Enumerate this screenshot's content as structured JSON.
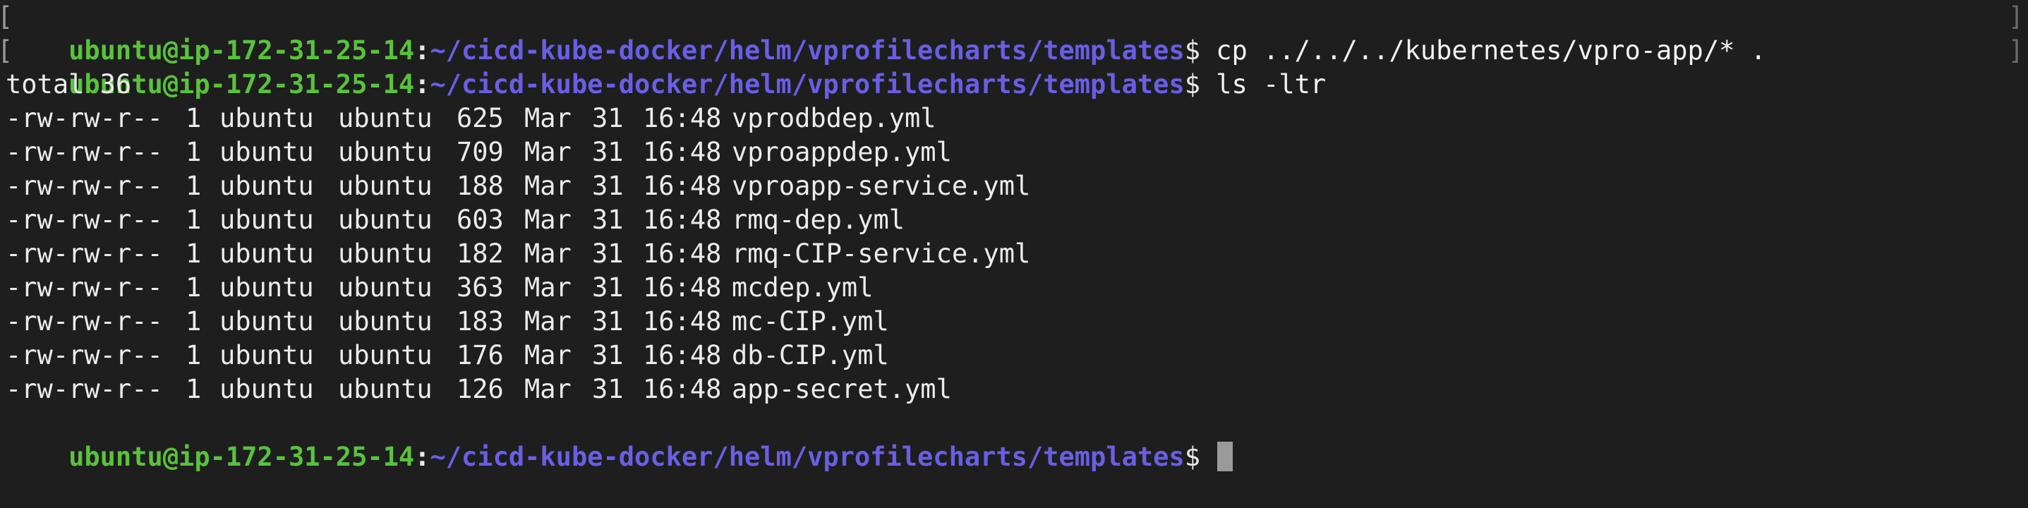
{
  "terminal": {
    "prompt": {
      "user_host": "ubuntu@ip-172-31-25-14",
      "colon": ":",
      "path": "~/cicd-kube-docker/helm/vprofilecharts/templates",
      "dollar": "$"
    },
    "commands": [
      "cp ../../../kubernetes/vpro-app/* .",
      "ls -ltr"
    ],
    "total_line": "total 36",
    "listing": [
      {
        "perm": "-rw-rw-r--",
        "links": "1",
        "owner": "ubuntu",
        "group": "ubuntu",
        "size": "625",
        "month": "Mar",
        "day": "31",
        "time": "16:48",
        "name": "vprodbdep.yml"
      },
      {
        "perm": "-rw-rw-r--",
        "links": "1",
        "owner": "ubuntu",
        "group": "ubuntu",
        "size": "709",
        "month": "Mar",
        "day": "31",
        "time": "16:48",
        "name": "vproappdep.yml"
      },
      {
        "perm": "-rw-rw-r--",
        "links": "1",
        "owner": "ubuntu",
        "group": "ubuntu",
        "size": "188",
        "month": "Mar",
        "day": "31",
        "time": "16:48",
        "name": "vproapp-service.yml"
      },
      {
        "perm": "-rw-rw-r--",
        "links": "1",
        "owner": "ubuntu",
        "group": "ubuntu",
        "size": "603",
        "month": "Mar",
        "day": "31",
        "time": "16:48",
        "name": "rmq-dep.yml"
      },
      {
        "perm": "-rw-rw-r--",
        "links": "1",
        "owner": "ubuntu",
        "group": "ubuntu",
        "size": "182",
        "month": "Mar",
        "day": "31",
        "time": "16:48",
        "name": "rmq-CIP-service.yml"
      },
      {
        "perm": "-rw-rw-r--",
        "links": "1",
        "owner": "ubuntu",
        "group": "ubuntu",
        "size": "363",
        "month": "Mar",
        "day": "31",
        "time": "16:48",
        "name": "mcdep.yml"
      },
      {
        "perm": "-rw-rw-r--",
        "links": "1",
        "owner": "ubuntu",
        "group": "ubuntu",
        "size": "183",
        "month": "Mar",
        "day": "31",
        "time": "16:48",
        "name": "mc-CIP.yml"
      },
      {
        "perm": "-rw-rw-r--",
        "links": "1",
        "owner": "ubuntu",
        "group": "ubuntu",
        "size": "176",
        "month": "Mar",
        "day": "31",
        "time": "16:48",
        "name": "db-CIP.yml"
      },
      {
        "perm": "-rw-rw-r--",
        "links": "1",
        "owner": "ubuntu",
        "group": "ubuntu",
        "size": "126",
        "month": "Mar",
        "day": "31",
        "time": "16:48",
        "name": "app-secret.yml"
      }
    ],
    "colors": {
      "background": "#1e1e1e",
      "user_host": "#59c23d",
      "path": "#6a5ee6",
      "text": "#e8e8e8",
      "cursor": "#9a9a9a"
    }
  }
}
